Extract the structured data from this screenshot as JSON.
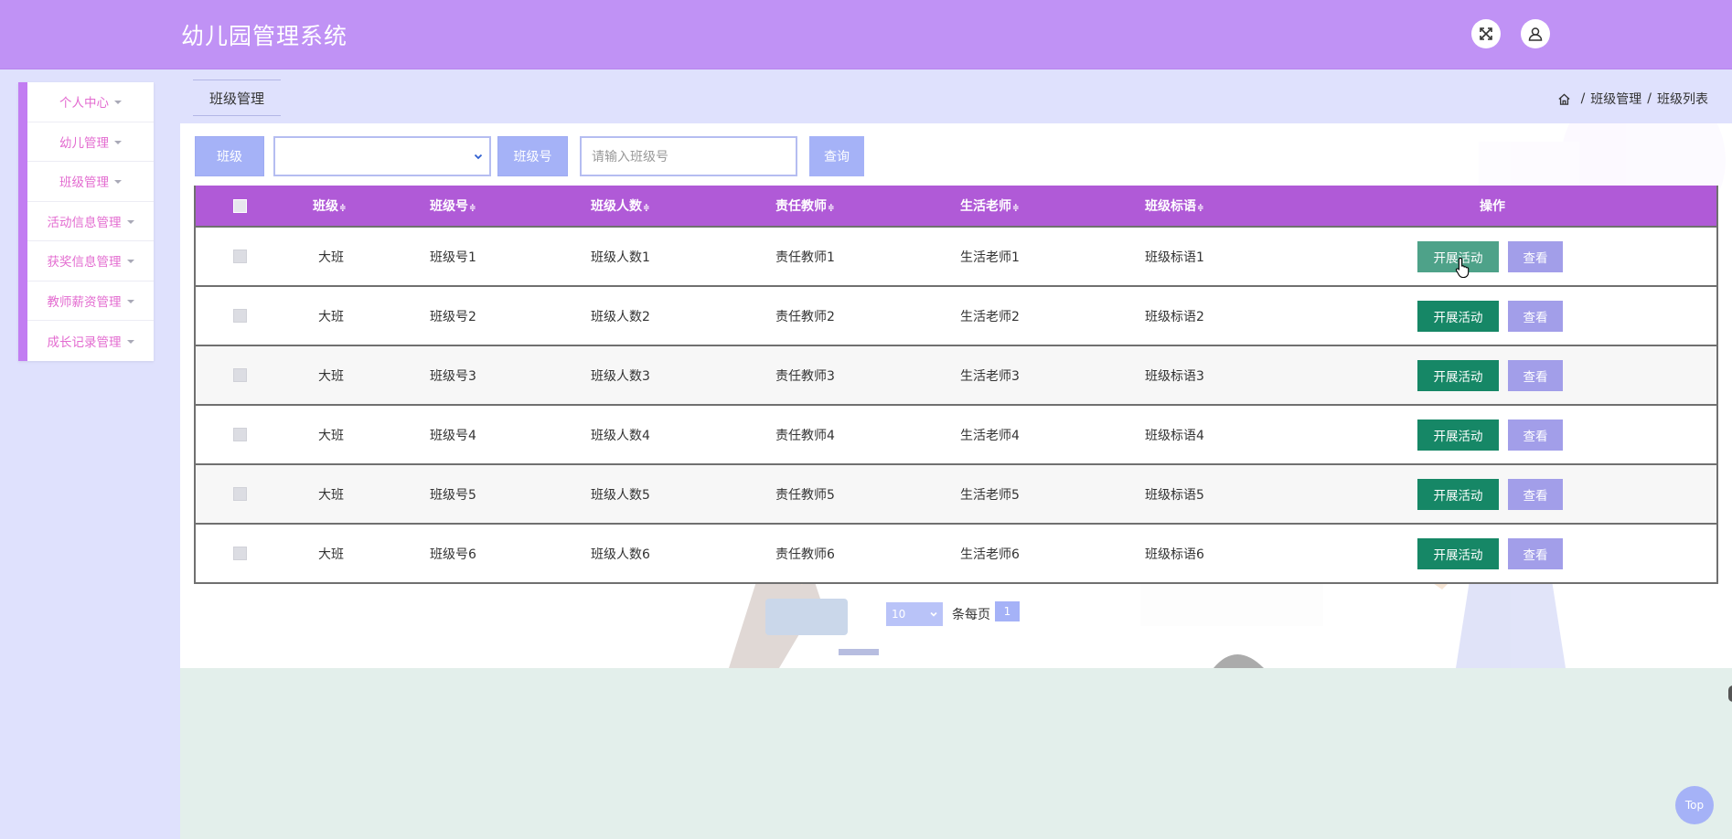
{
  "header": {
    "title": "幼儿园管理系统",
    "fullscreen_icon": "fullscreen-icon",
    "user_icon": "user-icon",
    "bg_color": "#c092f5"
  },
  "sidebar": {
    "accent_color": "#c27df2",
    "items": [
      {
        "label": "个人中心"
      },
      {
        "label": "幼儿管理"
      },
      {
        "label": "班级管理"
      },
      {
        "label": "活动信息管理"
      },
      {
        "label": "获奖信息管理"
      },
      {
        "label": "教师薪资管理"
      },
      {
        "label": "成长记录管理"
      }
    ]
  },
  "tabbar": {
    "active_tab": "班级管理"
  },
  "breadcrumb": {
    "home_icon": "home-icon",
    "level1": "班级管理",
    "level2": "班级列表",
    "separator": "/"
  },
  "search": {
    "class_label": "班级",
    "class_select_value": "",
    "number_label": "班级号",
    "number_placeholder": "请输入班级号",
    "query_button": "查询"
  },
  "table": {
    "header_color": "#b05ad7",
    "columns": [
      "班级",
      "班级号",
      "班级人数",
      "责任教师",
      "生活老师",
      "班级标语",
      "操作"
    ],
    "sort_mark": "≑",
    "rows": [
      {
        "class": "大班",
        "number": "班级号1",
        "count": "班级人数1",
        "teacher": "责任教师1",
        "life_teacher": "生活老师1",
        "slogan": "班级标语1"
      },
      {
        "class": "大班",
        "number": "班级号2",
        "count": "班级人数2",
        "teacher": "责任教师2",
        "life_teacher": "生活老师2",
        "slogan": "班级标语2"
      },
      {
        "class": "大班",
        "number": "班级号3",
        "count": "班级人数3",
        "teacher": "责任教师3",
        "life_teacher": "生活老师3",
        "slogan": "班级标语3"
      },
      {
        "class": "大班",
        "number": "班级号4",
        "count": "班级人数4",
        "teacher": "责任教师4",
        "life_teacher": "生活老师4",
        "slogan": "班级标语4"
      },
      {
        "class": "大班",
        "number": "班级号5",
        "count": "班级人数5",
        "teacher": "责任教师5",
        "life_teacher": "生活老师5",
        "slogan": "班级标语5"
      },
      {
        "class": "大班",
        "number": "班级号6",
        "count": "班级人数6",
        "teacher": "责任教师6",
        "life_teacher": "生活老师6",
        "slogan": "班级标语6"
      }
    ],
    "action_button": "开展活动",
    "view_button": "查看",
    "action_color": "#168766"
  },
  "pagination": {
    "page_size": "10",
    "per_page_label": "条每页",
    "current_page": "1"
  },
  "back_to_top": "Top"
}
